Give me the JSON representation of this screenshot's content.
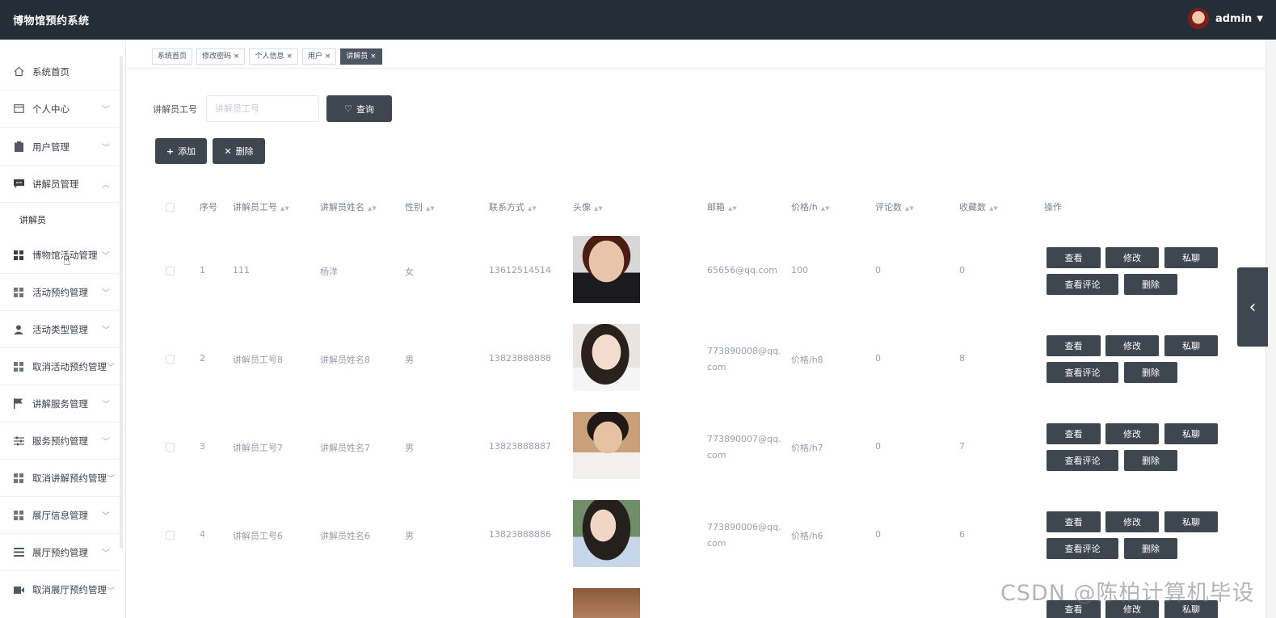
{
  "header": {
    "title": "博物馆预约系统",
    "username": "admin"
  },
  "sidebar": {
    "home": "系统首页",
    "personal": "个人中心",
    "users": "用户管理",
    "guides": "讲解员管理",
    "guides_sub": "讲解员",
    "museum_activity": "博物馆活动管理",
    "activity_booking": "活动预约管理",
    "activity_type": "活动类型管理",
    "cancel_activity": "取消活动预约管理",
    "guide_service": "讲解服务管理",
    "service_booking": "服务预约管理",
    "cancel_guide": "取消讲解预约管理",
    "hall_info": "展厅信息管理",
    "hall_booking": "展厅预约管理",
    "cancel_hall": "取消展厅预约管理"
  },
  "tabs": [
    "系统首页",
    "修改密码",
    "个人信息",
    "用户",
    "讲解员"
  ],
  "search": {
    "label": "讲解员工号",
    "placeholder": "讲解员工号",
    "button": "查询"
  },
  "actions": {
    "add": "添加",
    "delete": "删除"
  },
  "table": {
    "headers": [
      "序号",
      "讲解员工号",
      "讲解员姓名",
      "性别",
      "联系方式",
      "头像",
      "邮箱",
      "价格/h",
      "评论数",
      "收藏数",
      "操作"
    ],
    "rows": [
      {
        "idx": "1",
        "id": "111",
        "name": "杨洋",
        "gender": "女",
        "phone": "13612514514",
        "email": "65656@qq.com",
        "price": "100",
        "comments": "0",
        "favorites": "0"
      },
      {
        "idx": "2",
        "id": "讲解员工号8",
        "name": "讲解员姓名8",
        "gender": "男",
        "phone": "13823888888",
        "email": "773890008@qq.com",
        "price": "价格/h8",
        "comments": "0",
        "favorites": "8"
      },
      {
        "idx": "3",
        "id": "讲解员工号7",
        "name": "讲解员姓名7",
        "gender": "男",
        "phone": "13823888887",
        "email": "773890007@qq.com",
        "price": "价格/h7",
        "comments": "0",
        "favorites": "7"
      },
      {
        "idx": "4",
        "id": "讲解员工号6",
        "name": "讲解员姓名6",
        "gender": "男",
        "phone": "13823888886",
        "email": "773890006@qq.com",
        "price": "价格/h6",
        "comments": "0",
        "favorites": "6"
      }
    ],
    "op": {
      "view": "查看",
      "edit": "修改",
      "chat": "私聊",
      "reviews": "查看评论",
      "delete": "删除"
    }
  },
  "watermark": "CSDN @陈柏计算机毕设"
}
